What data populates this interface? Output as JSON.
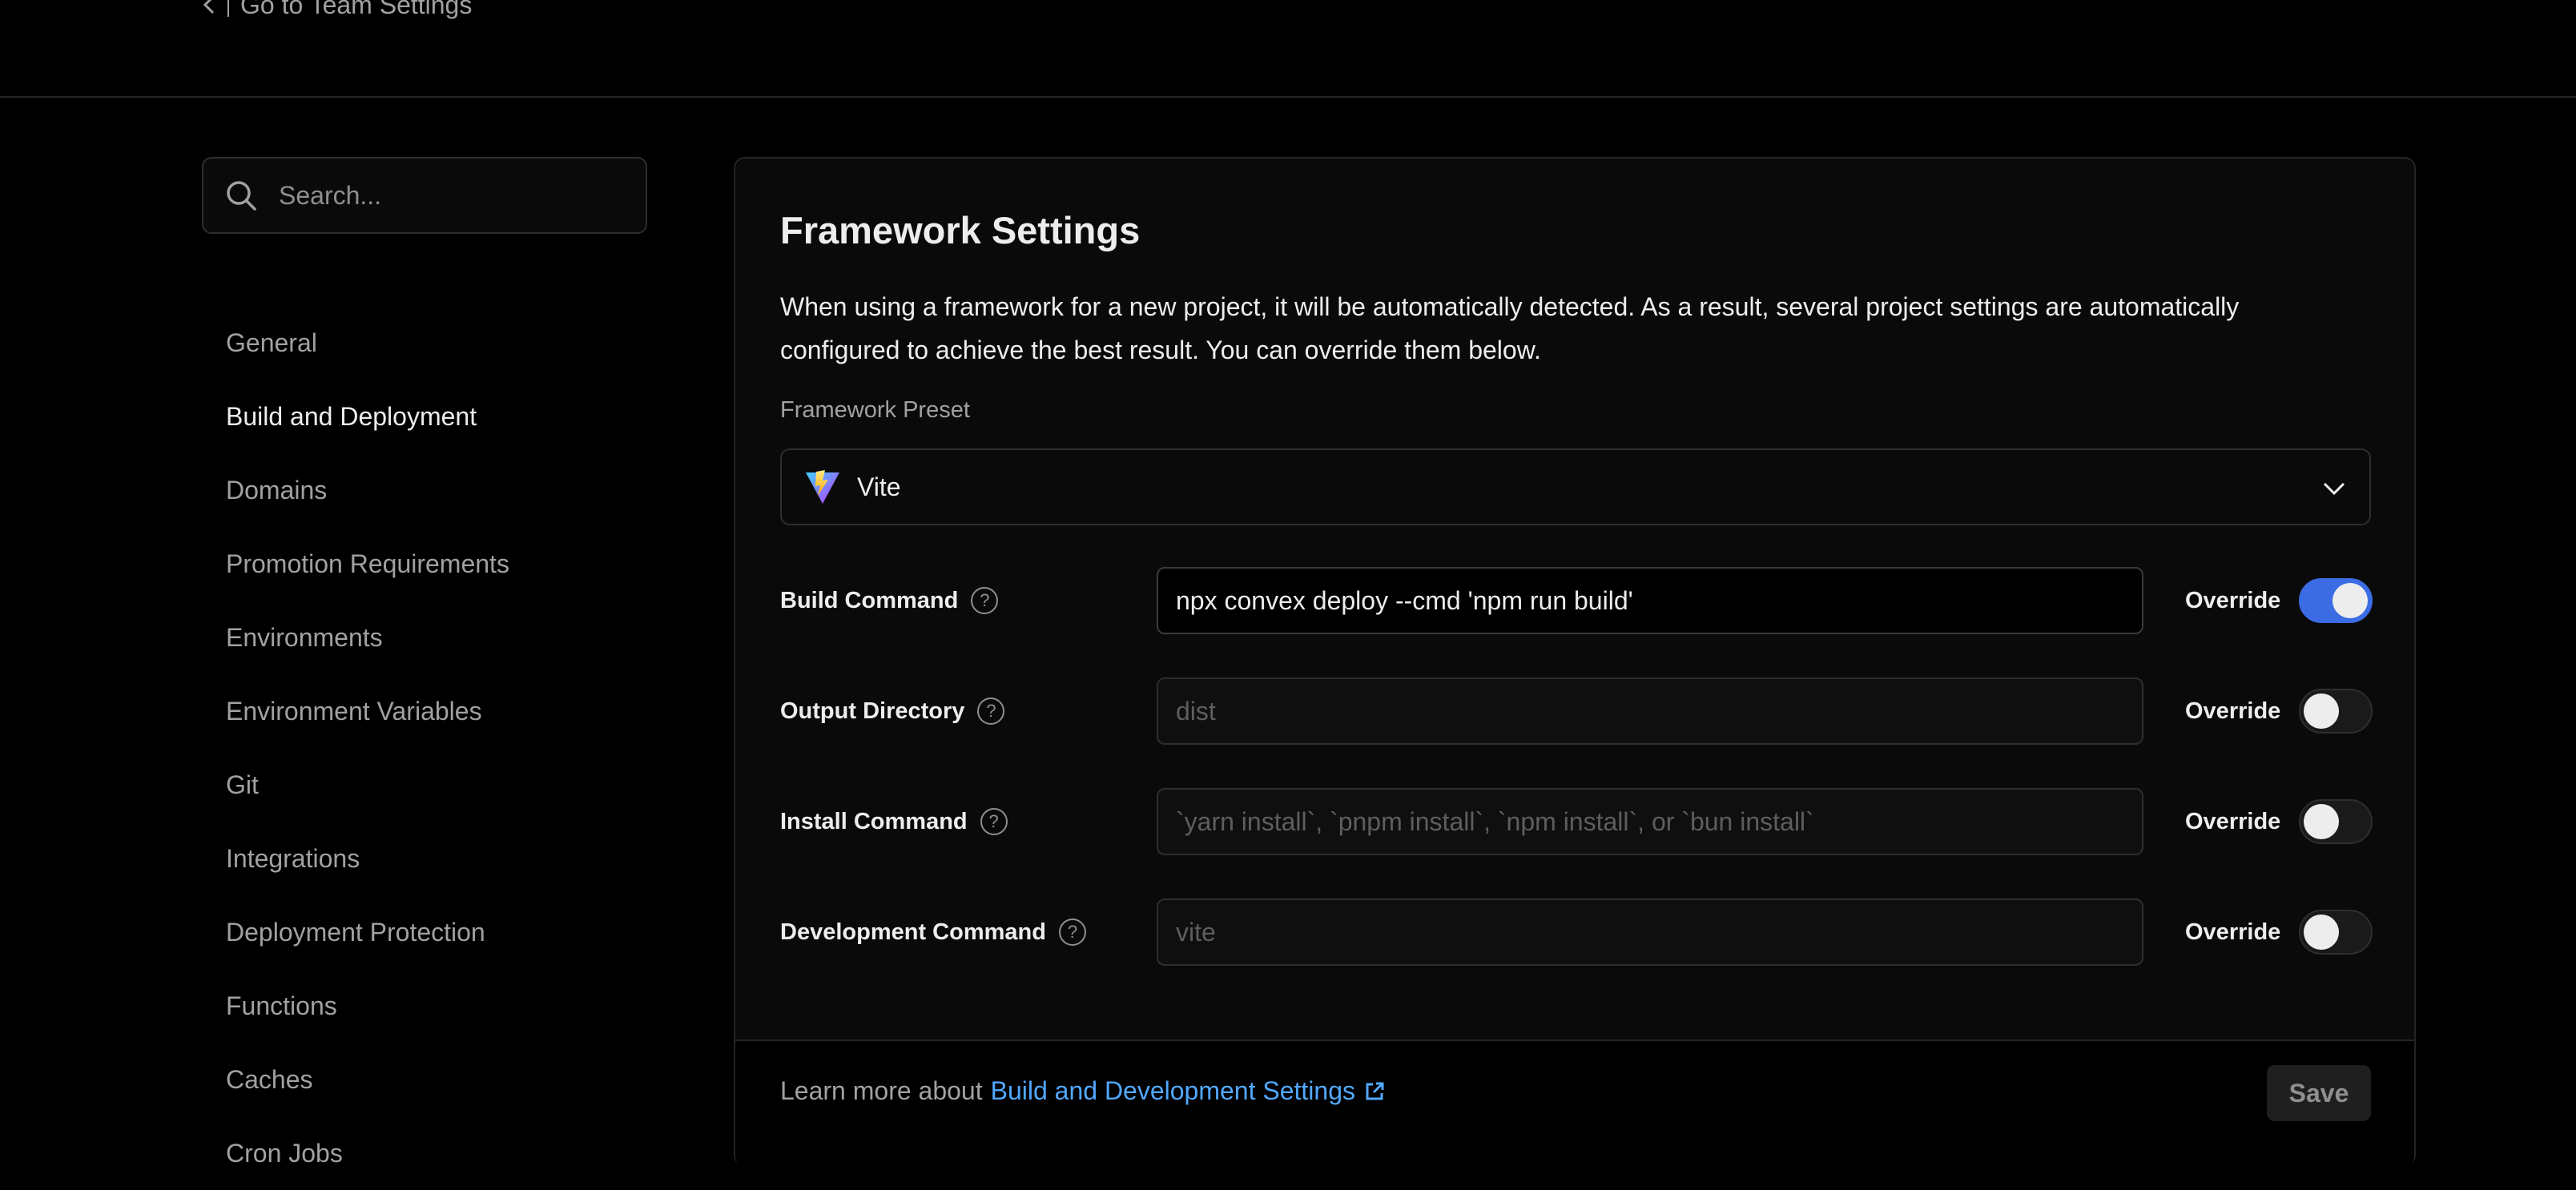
{
  "header": {
    "back_link": "Go to Team Settings"
  },
  "sidebar": {
    "search_placeholder": "Search...",
    "items": [
      {
        "label": "General"
      },
      {
        "label": "Build and Deployment"
      },
      {
        "label": "Domains"
      },
      {
        "label": "Promotion Requirements"
      },
      {
        "label": "Environments"
      },
      {
        "label": "Environment Variables"
      },
      {
        "label": "Git"
      },
      {
        "label": "Integrations"
      },
      {
        "label": "Deployment Protection"
      },
      {
        "label": "Functions"
      },
      {
        "label": "Caches"
      },
      {
        "label": "Cron Jobs"
      }
    ],
    "active_item": "Build and Deployment"
  },
  "framework": {
    "title": "Framework Settings",
    "description": "When using a framework for a new project, it will be automatically detected. As a result, several project settings are automatically configured to achieve the best result. You can override them below.",
    "preset_label": "Framework Preset",
    "preset_value": "Vite",
    "override_label": "Override",
    "fields": [
      {
        "label": "Build Command",
        "value": "npx convex deploy --cmd 'npm run build'",
        "placeholder": "",
        "override": true
      },
      {
        "label": "Output Directory",
        "value": "",
        "placeholder": "dist",
        "override": false
      },
      {
        "label": "Install Command",
        "value": "",
        "placeholder": "`yarn install`, `pnpm install`, `npm install`, or `bun install`",
        "override": false
      },
      {
        "label": "Development Command",
        "value": "",
        "placeholder": "vite",
        "override": false
      }
    ]
  },
  "footer": {
    "learn_more_prefix": "Learn more about",
    "learn_more_link": "Build and Development Settings",
    "save_label": "Save"
  },
  "colors": {
    "accent": "#3b6ce4",
    "link": "#52a8ff",
    "background": "#000000",
    "card": "#0a0a0a"
  }
}
